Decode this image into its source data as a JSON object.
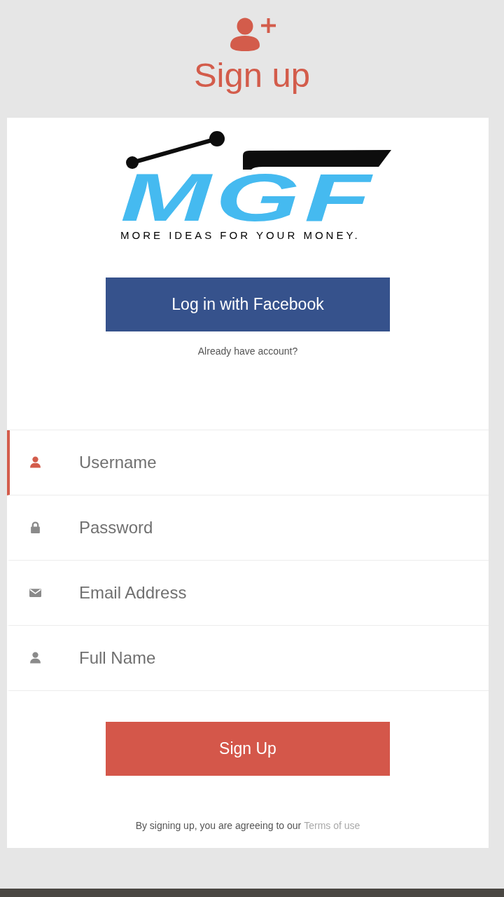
{
  "header": {
    "title": "Sign up"
  },
  "logo": {
    "wordmark": "MGF",
    "tagline": "MORE IDEAS FOR YOUR MONEY."
  },
  "facebook_button": {
    "label": "Log in with Facebook"
  },
  "login_link": {
    "label": "Already have account?"
  },
  "fields": [
    {
      "kind": "user",
      "placeholder": "Username",
      "focused": true
    },
    {
      "kind": "lock",
      "placeholder": "Password",
      "focused": false
    },
    {
      "kind": "mail",
      "placeholder": "Email Address",
      "focused": false
    },
    {
      "kind": "user",
      "placeholder": "Full Name",
      "focused": false
    }
  ],
  "signup_button": {
    "label": "Sign Up"
  },
  "terms": {
    "text": "By signing up, you are agreeing to our",
    "link": "Terms of use"
  }
}
